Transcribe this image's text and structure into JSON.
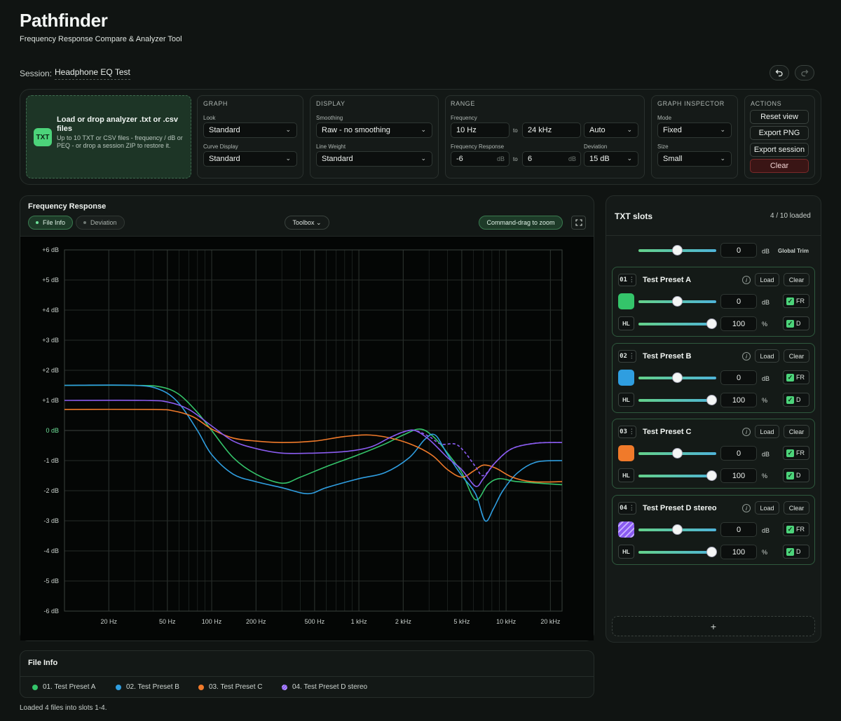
{
  "app": {
    "title": "Pathfinder",
    "subtitle": "Frequency Response Compare & Analyzer Tool",
    "session_label": "Session:",
    "session_name": "Headphone EQ Test",
    "undo_icon": "undo-icon",
    "redo_icon": "redo-icon"
  },
  "drop_zone": {
    "badge": "TXT",
    "title": "Load or drop analyzer .txt or .csv files",
    "description": "Up to 10 TXT or CSV files - frequency / dB or PEQ - or drop a session ZIP to restore it."
  },
  "graph_card": {
    "title": "GRAPH",
    "look_label": "Look",
    "look_value": "Standard",
    "curve_label": "Curve Display",
    "curve_value": "Standard"
  },
  "display_card": {
    "title": "DISPLAY",
    "smoothing_label": "Smoothing",
    "smoothing_value": "Raw - no smoothing",
    "weight_label": "Line Weight",
    "weight_value": "Standard"
  },
  "range_card": {
    "title": "RANGE",
    "freq_label": "Frequency",
    "freq_from": "10 Hz",
    "to": "to",
    "freq_to": "24 kHz",
    "freq_mode": "Auto",
    "fr_label": "Frequency Response",
    "fr_from": "-6",
    "fr_to": "6",
    "db_unit": "dB",
    "dev_label": "Deviation",
    "dev_value": "15 dB"
  },
  "inspector_card": {
    "title": "GRAPH INSPECTOR",
    "mode_label": "Mode",
    "mode_value": "Fixed",
    "size_label": "Size",
    "size_value": "Small"
  },
  "actions_card": {
    "title": "ACTIONS",
    "reset": "Reset view",
    "export_png": "Export PNG",
    "export_session": "Export session",
    "clear": "Clear"
  },
  "graph_panel": {
    "title": "Frequency Response",
    "tab_file_info": "File Info",
    "tab_deviation": "Deviation",
    "toolbox": "Toolbox",
    "zoom_hint": "Command-drag to zoom",
    "fullscreen_icon": "fullscreen-icon"
  },
  "chart_data": {
    "type": "line",
    "x_scale": "log",
    "xlim": [
      10,
      24000
    ],
    "ylim": [
      -6,
      6
    ],
    "x_ticks": [
      {
        "value": 20,
        "label": "20 Hz"
      },
      {
        "value": 50,
        "label": "50 Hz"
      },
      {
        "value": 100,
        "label": "100 Hz"
      },
      {
        "value": 200,
        "label": "200 Hz"
      },
      {
        "value": 500,
        "label": "500 Hz"
      },
      {
        "value": 1000,
        "label": "1 kHz"
      },
      {
        "value": 2000,
        "label": "2 kHz"
      },
      {
        "value": 5000,
        "label": "5 kHz"
      },
      {
        "value": 10000,
        "label": "10 kHz"
      },
      {
        "value": 20000,
        "label": "20 kHz"
      }
    ],
    "y_ticks": [
      {
        "value": 6,
        "label": "+6 dB"
      },
      {
        "value": 5,
        "label": "+5 dB"
      },
      {
        "value": 4,
        "label": "+4 dB"
      },
      {
        "value": 3,
        "label": "+3 dB"
      },
      {
        "value": 2,
        "label": "+2 dB"
      },
      {
        "value": 1,
        "label": "+1 dB"
      },
      {
        "value": 0,
        "label": "0 dB"
      },
      {
        "value": -1,
        "label": "-1 dB"
      },
      {
        "value": -2,
        "label": "-2 dB"
      },
      {
        "value": -3,
        "label": "-3 dB"
      },
      {
        "value": -4,
        "label": "-4 dB"
      },
      {
        "value": -5,
        "label": "-5 dB"
      },
      {
        "value": -6,
        "label": "-6 dB"
      }
    ],
    "grid": true,
    "series": [
      {
        "color": "#34c46a",
        "points": [
          [
            10,
            1.5
          ],
          [
            30,
            1.5
          ],
          [
            45,
            1.45
          ],
          [
            60,
            1.2
          ],
          [
            80,
            0.6
          ],
          [
            100,
            0.0
          ],
          [
            140,
            -0.9
          ],
          [
            200,
            -1.45
          ],
          [
            300,
            -1.75
          ],
          [
            400,
            -1.55
          ],
          [
            600,
            -1.2
          ],
          [
            1000,
            -0.8
          ],
          [
            1500,
            -0.45
          ],
          [
            2000,
            -0.15
          ],
          [
            2600,
            0.05
          ],
          [
            3200,
            -0.2
          ],
          [
            4000,
            -0.75
          ],
          [
            5000,
            -1.4
          ],
          [
            6200,
            -2.3
          ],
          [
            7500,
            -1.8
          ],
          [
            9000,
            -1.6
          ],
          [
            12000,
            -1.7
          ],
          [
            24000,
            -1.8
          ]
        ]
      },
      {
        "color": "#2f9ee0",
        "points": [
          [
            10,
            1.5
          ],
          [
            30,
            1.5
          ],
          [
            45,
            1.35
          ],
          [
            60,
            0.9
          ],
          [
            80,
            0.0
          ],
          [
            100,
            -0.8
          ],
          [
            140,
            -1.45
          ],
          [
            200,
            -1.7
          ],
          [
            300,
            -1.9
          ],
          [
            450,
            -2.1
          ],
          [
            600,
            -1.9
          ],
          [
            1000,
            -1.6
          ],
          [
            1500,
            -1.4
          ],
          [
            2200,
            -0.9
          ],
          [
            2800,
            -0.3
          ],
          [
            3300,
            -0.15
          ],
          [
            4000,
            -0.8
          ],
          [
            5000,
            -1.5
          ],
          [
            6200,
            -2.1
          ],
          [
            7200,
            -3.0
          ],
          [
            8200,
            -2.6
          ],
          [
            9500,
            -2.0
          ],
          [
            12000,
            -1.4
          ],
          [
            16000,
            -1.05
          ],
          [
            24000,
            -1.0
          ]
        ]
      },
      {
        "color": "#f07a2a",
        "points": [
          [
            10,
            0.7
          ],
          [
            40,
            0.7
          ],
          [
            55,
            0.65
          ],
          [
            75,
            0.45
          ],
          [
            100,
            0.05
          ],
          [
            140,
            -0.25
          ],
          [
            200,
            -0.35
          ],
          [
            300,
            -0.4
          ],
          [
            500,
            -0.35
          ],
          [
            800,
            -0.2
          ],
          [
            1200,
            -0.15
          ],
          [
            1800,
            -0.3
          ],
          [
            2500,
            -0.55
          ],
          [
            3200,
            -0.85
          ],
          [
            4000,
            -1.3
          ],
          [
            5000,
            -1.55
          ],
          [
            6000,
            -1.35
          ],
          [
            7000,
            -1.15
          ],
          [
            8500,
            -1.25
          ],
          [
            11000,
            -1.55
          ],
          [
            15000,
            -1.7
          ],
          [
            24000,
            -1.7
          ]
        ]
      },
      {
        "color": "#8a5cf0",
        "points": [
          [
            10,
            1.0
          ],
          [
            35,
            1.0
          ],
          [
            50,
            0.95
          ],
          [
            70,
            0.7
          ],
          [
            100,
            0.15
          ],
          [
            140,
            -0.35
          ],
          [
            200,
            -0.6
          ],
          [
            300,
            -0.75
          ],
          [
            500,
            -0.75
          ],
          [
            800,
            -0.7
          ],
          [
            1200,
            -0.55
          ],
          [
            1600,
            -0.25
          ],
          [
            2000,
            -0.05
          ],
          [
            2400,
            0.0
          ],
          [
            3000,
            -0.3
          ],
          [
            4000,
            -0.9
          ],
          [
            5000,
            -1.3
          ],
          [
            6200,
            -1.85
          ],
          [
            7000,
            -1.6
          ],
          [
            8500,
            -1.05
          ],
          [
            11000,
            -0.6
          ],
          [
            16000,
            -0.42
          ],
          [
            24000,
            -0.4
          ]
        ]
      },
      {
        "color": "#8a5cf0",
        "dashed": true,
        "points": [
          [
            1600,
            -0.25
          ],
          [
            2000,
            -0.05
          ],
          [
            2400,
            0.0
          ],
          [
            3000,
            -0.2
          ],
          [
            3600,
            -0.45
          ],
          [
            4500,
            -0.45
          ],
          [
            5200,
            -0.7
          ],
          [
            6200,
            -1.2
          ],
          [
            7000,
            -1.5
          ],
          [
            8500,
            -1.05
          ],
          [
            11000,
            -0.6
          ],
          [
            16000,
            -0.42
          ],
          [
            24000,
            -0.4
          ]
        ]
      }
    ]
  },
  "file_info": {
    "title": "File Info",
    "items": [
      {
        "label": "01. Test Preset A",
        "color": "#34c46a"
      },
      {
        "label": "02. Test Preset B",
        "color": "#2f9ee0"
      },
      {
        "label": "03. Test Preset C",
        "color": "#f07a2a"
      },
      {
        "label": "04. Test Preset D stereo",
        "color": "#8a5cf0"
      }
    ],
    "status": "Loaded 4 files into slots 1-4."
  },
  "slots": {
    "title": "TXT slots",
    "count": "4 / 10 loaded",
    "global_trim_value": "0",
    "global_trim_unit": "dB",
    "global_trim_label": "Global Trim",
    "add_label": "+",
    "items": [
      {
        "num": "01",
        "name": "Test Preset A",
        "color": "#34c46a",
        "load": "Load",
        "clear": "Clear",
        "db_value": "0",
        "db_unit": "dB",
        "level_value": "100",
        "level_unit": "%",
        "hl": "HL",
        "fr": "FR",
        "d": "D",
        "check": "✓"
      },
      {
        "num": "02",
        "name": "Test Preset B",
        "color": "#2f9ee0",
        "load": "Load",
        "clear": "Clear",
        "db_value": "0",
        "db_unit": "dB",
        "level_value": "100",
        "level_unit": "%",
        "hl": "HL",
        "fr": "FR",
        "d": "D",
        "check": "✓"
      },
      {
        "num": "03",
        "name": "Test Preset C",
        "color": "#f07a2a",
        "load": "Load",
        "clear": "Clear",
        "db_value": "0",
        "db_unit": "dB",
        "level_value": "100",
        "level_unit": "%",
        "hl": "HL",
        "fr": "FR",
        "d": "D",
        "check": "✓"
      },
      {
        "num": "04",
        "name": "Test Preset D stereo",
        "color": "#8a5cf0",
        "load": "Load",
        "clear": "Clear",
        "db_value": "0",
        "db_unit": "dB",
        "level_value": "100",
        "level_unit": "%",
        "hl": "HL",
        "fr": "FR",
        "d": "D",
        "check": "✓"
      }
    ]
  }
}
